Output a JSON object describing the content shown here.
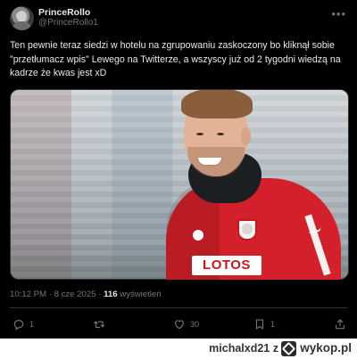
{
  "tweet": {
    "display_name": "PrinceRollo",
    "handle": "@PrinceRollo1",
    "text": "Ten pewnie teraz siedzi w hotelu na zgrupowaniu zaskoczony bo kliknął sobie \"przetłumacz wpis\" Lewego na Twitterze, a wszyscy już od 2 tygodni wiedzą na kadrze że kwas jest xD",
    "timestamp": "10:12 PM · 8 cze 2025 · ",
    "views_count": "116",
    "views_label": " wyświetleń",
    "media": {
      "sponsor_text": "LOTOS",
      "description_icon": "photo"
    },
    "actions": {
      "reply_count": "1",
      "retweet_count": "",
      "like_count": "30",
      "bookmark_count": "1",
      "share_count": ""
    }
  },
  "watermark": {
    "username": "michalxd21",
    "separator": "z",
    "site": "wykop.pl"
  },
  "colors": {
    "background": "#000000",
    "text_primary": "#e7e9ea",
    "text_secondary": "#71767b",
    "divider": "#2f3336",
    "shirt_red": "#d4202a"
  },
  "icons": [
    "more-icon",
    "reply-icon",
    "retweet-icon",
    "like-icon",
    "bookmark-icon",
    "share-icon",
    "wykop-logo-icon"
  ]
}
